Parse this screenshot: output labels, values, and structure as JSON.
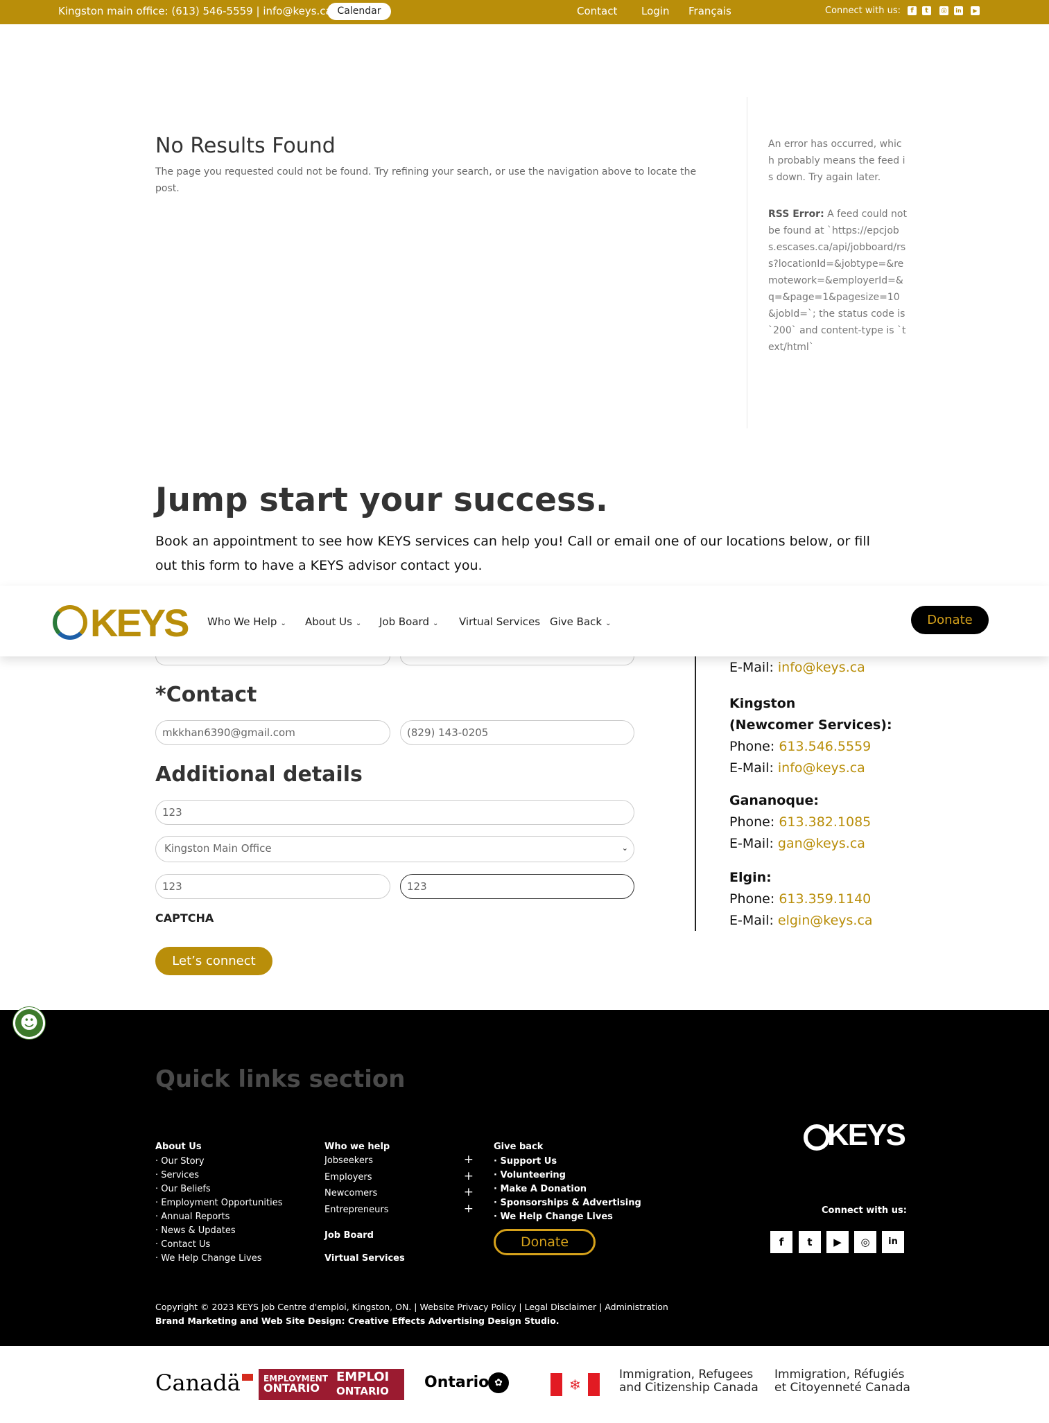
{
  "topbar": {
    "office": "Kingston main office: (613) 546-5559 | info@keys.ca",
    "calendar": "Calendar",
    "contact": "Contact",
    "login": "Login",
    "francais": "Français",
    "connect": "Connect with us:",
    "social": [
      "f",
      "t",
      "◎",
      "in",
      "▶"
    ]
  },
  "noresults": {
    "title": "No Results Found",
    "text": "The page you requested could not be found. Try refining your search, or use the navigation above to locate the post."
  },
  "rss": {
    "error": "An error has occurred, which probably means the feed is down. Try again later.",
    "label": "RSS Error:",
    "detail": " A feed could not be found at `https://epcjobs.escases.ca/api/jobboard/rss?locationId=&jobtype=&remotework=&employerId=&q=&page=1&pagesize=10&jobId=`; the status code is `200` and content-type is `text/html`"
  },
  "jump": {
    "title": "Jump start your success.",
    "text": "Book an appointment to see how KEYS services can help you! Call or email one of our locations below, or fill out this form to have a KEYS advisor contact you."
  },
  "nav": {
    "logo": "KEYS",
    "items": [
      "Who We Help",
      "About Us",
      "Job Board",
      "Virtual Services",
      "Give Back"
    ],
    "donate": "Donate"
  },
  "form": {
    "contact_heading": "*Contact",
    "email": "mkkhan6390@gmail.com",
    "phone": "(829) 143-0205",
    "details_heading": "Additional details",
    "detail1": "123",
    "office_select": "Kingston Main Office",
    "detail2": "123",
    "detail3": "123",
    "captcha": "CAPTCHA",
    "submit": "Let’s connect"
  },
  "locations": {
    "email_label": "E-Mail:",
    "phone_label": "Phone:",
    "first_email": "info@keys.ca",
    "kingston_name1": "Kingston",
    "kingston_name2": "(Newcomer Services):",
    "kingston_phone": "613.546.5559",
    "kingston_email": "info@keys.ca",
    "gan_name": "Gananoque:",
    "gan_phone": "613.382.1085",
    "gan_email": "gan@keys.ca",
    "elgin_name": "Elgin:",
    "elgin_phone": "613.359.1140",
    "elgin_email": "elgin@keys.ca"
  },
  "footer": {
    "ql_title": "Quick links section",
    "about_head": "About Us",
    "about_items": [
      "· Our Story",
      "· Services",
      "· Our Beliefs",
      "· Employment Opportunities",
      "· Annual Reports",
      "· News & Updates",
      "· Contact Us",
      "· We Help Change Lives"
    ],
    "help_head": "Who we help",
    "help_items": [
      "Jobseekers",
      "Employers",
      "Newcomers",
      "Entrepreneurs"
    ],
    "job_board": "Job Board",
    "virtual": "Virtual Services",
    "give_head": "Give back",
    "give_items": [
      "· Support Us",
      "· Volunteering",
      "· Make A Donation",
      "· Sponsorships & Advertising",
      "· We Help Change Lives"
    ],
    "donate": "Donate",
    "logo": "KEYS",
    "connect": "Connect with us:",
    "social": [
      "f",
      "t",
      "▶",
      "◎",
      "in"
    ],
    "copyright": "Copyright © 2023 KEYS Job Centre d'emploi, Kingston, ON. | Website Privacy Policy | Legal Disclaimer | Administration",
    "design": "Brand Marketing and Web Site Design: Creative Effects Advertising Design Studio."
  },
  "partners": {
    "canada": "Canadä",
    "eo_left1": "EMPLOYMENT",
    "eo_left2": "ONTARIO",
    "eo_right1": "EMPLOI",
    "eo_right2": "ONTARIO",
    "ontario": "Ontario",
    "ircc_en1": "Immigration, Refugees",
    "ircc_en2": "and Citizenship Canada",
    "ircc_fr1": "Immigration, Réfugiés",
    "ircc_fr2": "et Citoyenneté Canada"
  }
}
